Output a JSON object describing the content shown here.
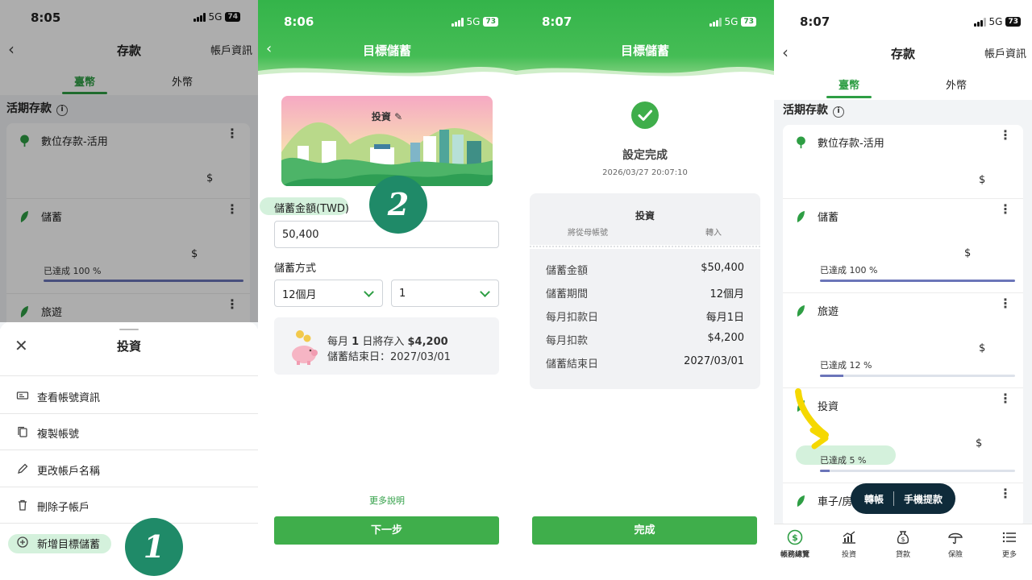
{
  "panel1": {
    "status": {
      "time": "8:05",
      "network": "5G",
      "battery": "74"
    },
    "title": "存款",
    "account_info": "帳戶資訊",
    "tabs": [
      "臺幣",
      "外幣"
    ],
    "section": "活期存款",
    "accounts": [
      {
        "name": "數位存款-活用",
        "amount": "$",
        "icon": "tree-icon"
      },
      {
        "name": "儲蓄",
        "amount": "$",
        "achieved": "已達成 100 %",
        "progress": 1.0,
        "icon": "leaf-icon"
      },
      {
        "name": "旅遊",
        "icon": "leaf-icon"
      }
    ],
    "sheet": {
      "title": "投資",
      "items": [
        {
          "label": "查看帳號資訊",
          "icon": "account-card-icon"
        },
        {
          "label": "複製帳號",
          "icon": "copy-icon"
        },
        {
          "label": "更改帳戶名稱",
          "icon": "pencil-icon"
        },
        {
          "label": "刪除子帳戶",
          "icon": "trash-icon"
        },
        {
          "label": "新增目標儲蓄",
          "icon": "plus-circle-icon"
        }
      ]
    },
    "step_marker": "1"
  },
  "panel2": {
    "status": {
      "time": "8:06",
      "network": "5G",
      "battery": "73"
    },
    "title": "目標儲蓄",
    "card_label": "投資",
    "amount_label": "儲蓄金額(TWD)",
    "amount_value": "50,400",
    "method_label": "儲蓄方式",
    "period_value": "12個月",
    "day_value": "1",
    "summary_line1_prefix": "每月",
    "summary_line1_day": "1",
    "summary_line1_mid": "日將存入",
    "summary_line1_amount": "$4,200",
    "summary_line2": "儲蓄結束日：2027/03/01",
    "more_link": "更多說明",
    "next_button": "下一步",
    "step_marker": "2"
  },
  "panel3": {
    "status": {
      "time": "8:07",
      "network": "5G",
      "battery": "73"
    },
    "title": "目標儲蓄",
    "done_title": "設定完成",
    "timestamp": "2026/03/27 20:07:10",
    "account_name": "投資",
    "from_label": "將從母帳號",
    "to_label": "轉入",
    "details": [
      {
        "k": "儲蓄金額",
        "v": "$50,400"
      },
      {
        "k": "儲蓄期間",
        "v": "12個月"
      },
      {
        "k": "每月扣款日",
        "v": "每月1日"
      },
      {
        "k": "每月扣款",
        "v": "$4,200"
      },
      {
        "k": "儲蓄結束日",
        "v": "2027/03/01"
      }
    ],
    "finish_button": "完成"
  },
  "panel4": {
    "status": {
      "time": "8:07",
      "network": "5G",
      "battery": "73"
    },
    "title": "存款",
    "account_info": "帳戶資訊",
    "tabs": [
      "臺幣",
      "外幣"
    ],
    "section": "活期存款",
    "accounts": [
      {
        "name": "數位存款-活用",
        "amount": "$",
        "icon": "tree-icon"
      },
      {
        "name": "儲蓄",
        "amount": "$",
        "achieved": "已達成 100 %",
        "progress": 1.0,
        "icon": "leaf-icon"
      },
      {
        "name": "旅遊",
        "amount": "$",
        "achieved": "已達成 12 %",
        "progress": 0.12,
        "icon": "leaf-icon"
      },
      {
        "name": "投資",
        "amount": "$",
        "achieved": "已達成 5 %",
        "progress": 0.05,
        "icon": "leaf-icon"
      },
      {
        "name": "車子/房",
        "icon": "leaf-icon"
      }
    ],
    "float_buttons": [
      "轉帳",
      "手機提款"
    ],
    "tabbar": [
      "帳務總覽",
      "投資",
      "貸款",
      "保險",
      "更多"
    ]
  },
  "colors": {
    "brand_green": "#3fae4b",
    "progress": "#6b75b9",
    "highlight": "#d4f1dc",
    "marker": "#1f8a68",
    "arrow": "#f5d800"
  }
}
